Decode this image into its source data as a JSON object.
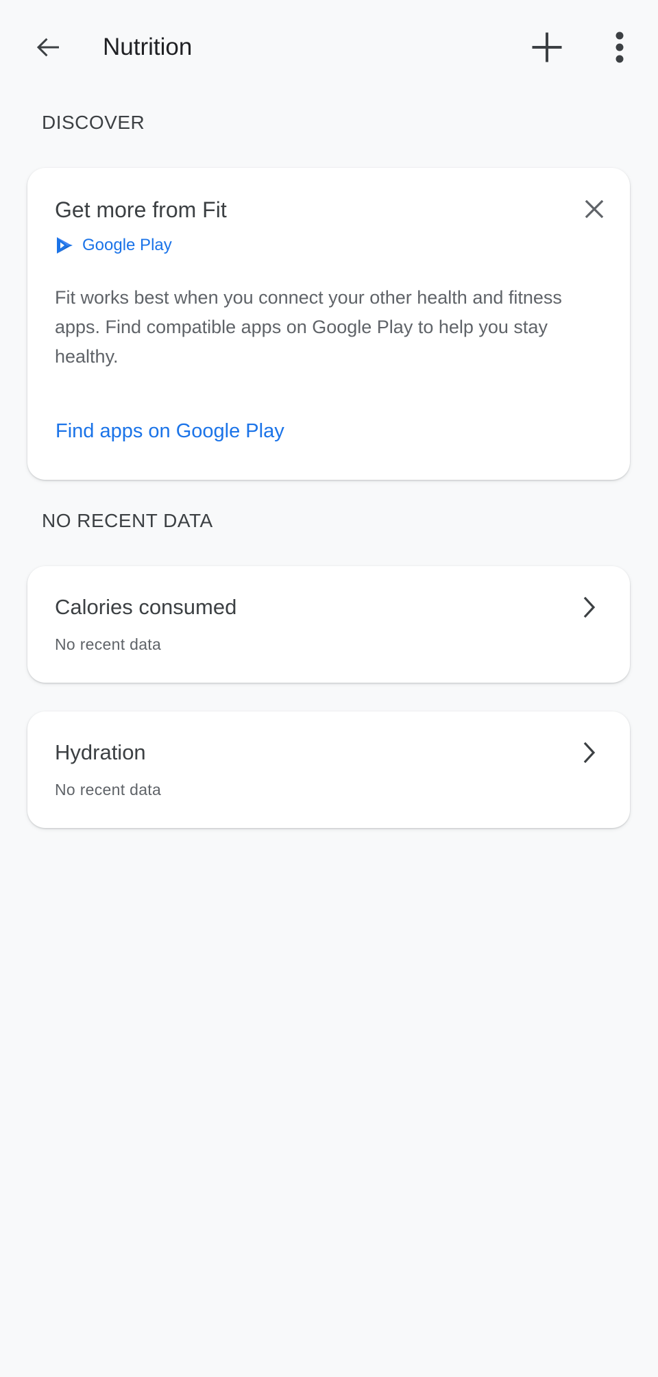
{
  "app_bar": {
    "title": "Nutrition",
    "back_icon": "arrow-back-icon",
    "add_icon": "add-icon",
    "more_icon": "more-vert-icon"
  },
  "discover": {
    "section_label": "DISCOVER",
    "card": {
      "title": "Get more from Fit",
      "source_label": "Google Play",
      "source_icon": "google-play-icon",
      "body": "Fit works best when you connect your other health and fitness apps. Find compatible apps on Google Play to help you stay healthy.",
      "link_label": "Find apps on Google Play",
      "close_icon": "close-icon"
    }
  },
  "recent": {
    "section_label": "NO RECENT DATA",
    "items": [
      {
        "title": "Calories consumed",
        "subtitle": "No recent data"
      },
      {
        "title": "Hydration",
        "subtitle": "No recent data"
      }
    ]
  },
  "colors": {
    "background": "#f8f9fa",
    "card": "#ffffff",
    "text_primary": "#3c4043",
    "text_secondary": "#5f6368",
    "accent": "#1a73e8"
  }
}
